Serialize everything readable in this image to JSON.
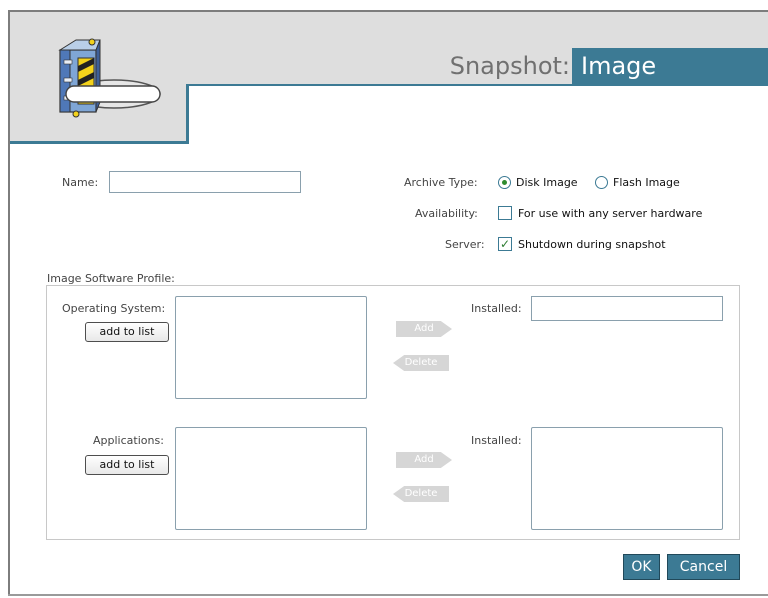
{
  "header": {
    "title_prefix": "Snapshot:",
    "title_highlight": "Image",
    "logo_icon": "server-snapshot-icon"
  },
  "form": {
    "name_label": "Name:",
    "name_value": "",
    "archive_type_label": "Archive Type:",
    "archive_options": [
      {
        "label": "Disk Image",
        "selected": true
      },
      {
        "label": "Flash Image",
        "selected": false
      }
    ],
    "availability_label": "Availability:",
    "availability_checkbox": {
      "label": "For use with any server hardware",
      "checked": false
    },
    "server_label": "Server:",
    "server_checkbox": {
      "label": "Shutdown during snapshot",
      "checked": true
    }
  },
  "profile": {
    "legend": "Image Software Profile:",
    "os": {
      "label": "Operating System:",
      "add_to_list": "add to list",
      "add_button": "Add",
      "delete_button": "Delete",
      "installed_label": "Installed:",
      "installed_value": ""
    },
    "apps": {
      "label": "Applications:",
      "add_to_list": "add to list",
      "add_button": "Add",
      "delete_button": "Delete",
      "installed_label": "Installed:"
    }
  },
  "actions": {
    "ok": "OK",
    "cancel": "Cancel"
  },
  "colors": {
    "accent": "#3c7a94",
    "header_bg": "#dedede",
    "check_green": "#2e8b2e"
  }
}
